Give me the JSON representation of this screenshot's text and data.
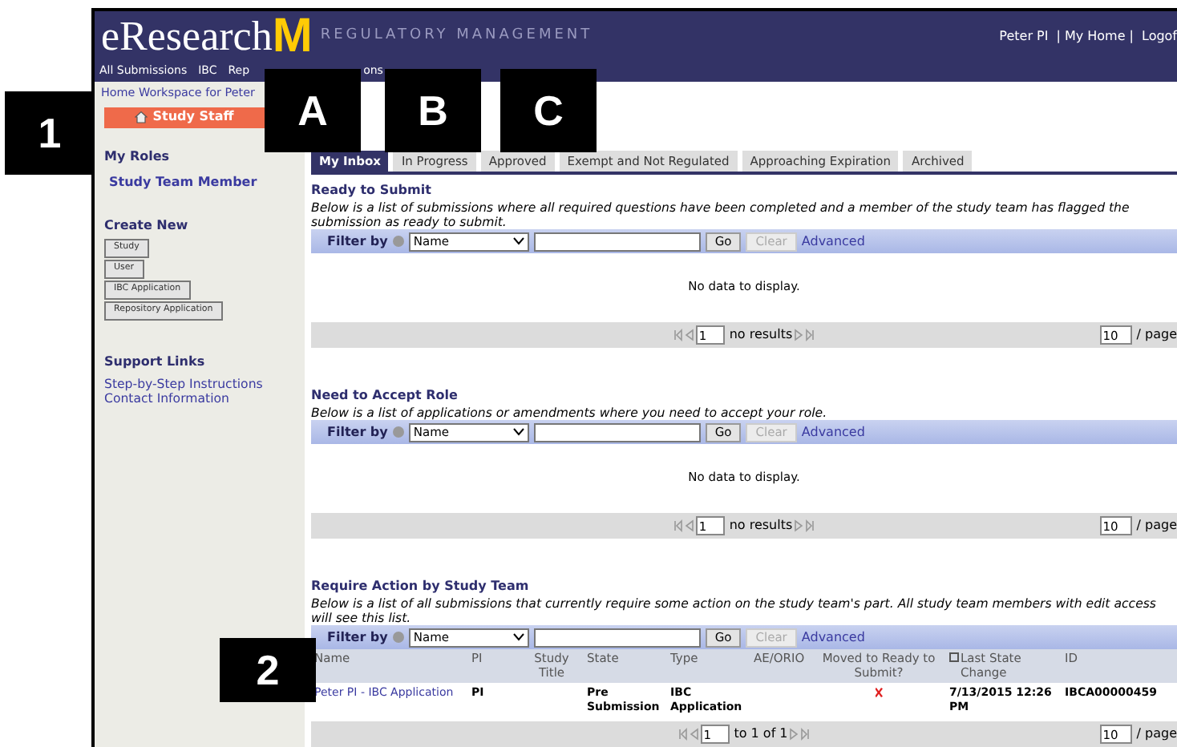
{
  "header": {
    "logo_text": "eResearch",
    "logo_mark": "M",
    "subtitle": "REGULATORY MANAGEMENT",
    "user_links": [
      "Peter PI",
      "| My Home |",
      "Logof"
    ]
  },
  "menu": [
    "All Submissions",
    "IBC",
    "Rep",
    "ons"
  ],
  "breadcrumb": "Home Workspace for Peter",
  "sidebar": {
    "workspace_button": "Study Staff",
    "roles_title": "My Roles",
    "roles": [
      "Study Team Member"
    ],
    "create_title": "Create New",
    "create_buttons": [
      "Study",
      "User",
      "IBC Application",
      "Repository Application"
    ],
    "support_title": "Support Links",
    "support_links": [
      "Step-by-Step Instructions",
      "Contact Information"
    ]
  },
  "tabs": [
    {
      "label": "My Inbox",
      "selected": true
    },
    {
      "label": "In Progress",
      "selected": false
    },
    {
      "label": "Approved",
      "selected": false
    },
    {
      "label": "Exempt and Not Regulated",
      "selected": false
    },
    {
      "label": "Approaching Expiration",
      "selected": false
    },
    {
      "label": "Archived",
      "selected": false
    }
  ],
  "sections": [
    {
      "title": "Ready to Submit",
      "description": "Below is a list of submissions where all required questions have been completed and a member of the study team has flagged the submission as ready to submit.",
      "filter": {
        "label": "Filter by",
        "field": "Name",
        "go": "Go",
        "clear": "Clear",
        "clear_disabled": true,
        "advanced": "Advanced"
      },
      "empty_message": "No data to display.",
      "pager": {
        "page": "1",
        "status": "no results",
        "per_page": "10",
        "per_page_label": "/ page"
      }
    },
    {
      "title": "Need to Accept Role",
      "description": "Below is a list of applications or amendments where you need to accept your role.",
      "filter": {
        "label": "Filter by",
        "field": "Name",
        "go": "Go",
        "clear": "Clear",
        "clear_disabled": true,
        "advanced": "Advanced"
      },
      "empty_message": "No data to display.",
      "pager": {
        "page": "1",
        "status": "no results",
        "per_page": "10",
        "per_page_label": "/ page"
      }
    },
    {
      "title": "Require Action by Study Team",
      "description": "Below is a list of all submissions that currently require some action on the study team's part. All study team members with edit access will see this list.",
      "filter": {
        "label": "Filter by",
        "field": "Name",
        "go": "Go",
        "clear": "Clear",
        "clear_disabled": true,
        "advanced": "Advanced"
      },
      "columns": [
        {
          "label": "Name",
          "sorted": false
        },
        {
          "label": "PI",
          "sorted": false
        },
        {
          "label": "Study Title",
          "sorted": false
        },
        {
          "label": "State",
          "sorted": false
        },
        {
          "label": "Type",
          "sorted": false
        },
        {
          "label": "AE/ORIO",
          "sorted": false
        },
        {
          "label": "Moved to Ready to Submit?",
          "sorted": false
        },
        {
          "label": "Last State Change",
          "sorted": true
        },
        {
          "label": "ID",
          "sorted": false
        }
      ],
      "rows": [
        {
          "name": "Peter PI - IBC Application",
          "pi": "PI",
          "state": "Pre Submission",
          "type": "IBC Application",
          "moved_to_ready": false,
          "last_state_change": "7/13/2015 12:26 PM",
          "id": "IBCA00000459"
        }
      ],
      "pager": {
        "page": "1",
        "status": "to 1 of 1",
        "per_page": "10",
        "per_page_label": "/ page"
      }
    }
  ],
  "callouts": [
    {
      "label": "1"
    },
    {
      "label": "A"
    },
    {
      "label": "B"
    },
    {
      "label": "C"
    },
    {
      "label": "2"
    }
  ]
}
